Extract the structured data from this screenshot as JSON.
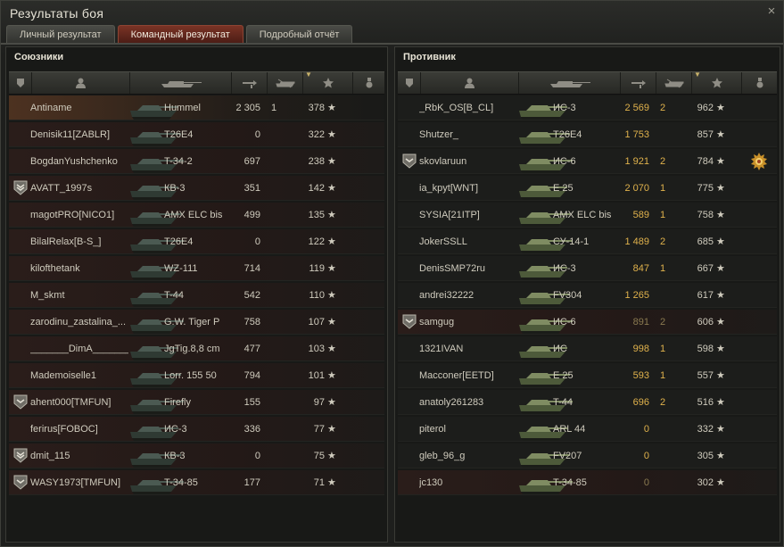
{
  "window": {
    "title": "Результаты боя",
    "close_label": "×"
  },
  "tabs": [
    {
      "label": "Личный результат",
      "active": false
    },
    {
      "label": "Командный результат",
      "active": true
    },
    {
      "label": "Подробный отчёт",
      "active": false
    }
  ],
  "allies": {
    "title": "Союзники",
    "rows": [
      {
        "player": "Antiname",
        "vehicle": "Hummel",
        "damage": "2 305",
        "kills": "1",
        "xp": "378",
        "badge": "",
        "state": "self"
      },
      {
        "player": "Denisik11[ZABLR]",
        "vehicle": "T26E4",
        "damage": "0",
        "kills": "",
        "xp": "322",
        "badge": "",
        "state": "dead"
      },
      {
        "player": "BogdanYushchenko",
        "vehicle": "T-34-2",
        "damage": "697",
        "kills": "",
        "xp": "238",
        "badge": "",
        "state": "dead"
      },
      {
        "player": "AVATT_1997s",
        "vehicle": "КВ-3",
        "damage": "351",
        "kills": "",
        "xp": "142",
        "badge": "2",
        "state": "dead"
      },
      {
        "player": "magotPRO[NICO1]",
        "vehicle": "AMX ELC bis",
        "damage": "499",
        "kills": "",
        "xp": "135",
        "badge": "",
        "state": "dead"
      },
      {
        "player": "BilalRelax[B-S_]",
        "vehicle": "T26E4",
        "damage": "0",
        "kills": "",
        "xp": "122",
        "badge": "",
        "state": "dead"
      },
      {
        "player": "kilofthetank",
        "vehicle": "WZ-111",
        "damage": "714",
        "kills": "",
        "xp": "119",
        "badge": "",
        "state": "dead"
      },
      {
        "player": "M_skmt",
        "vehicle": "T-44",
        "damage": "542",
        "kills": "",
        "xp": "110",
        "badge": "",
        "state": "dead"
      },
      {
        "player": "zarodinu_zastalina_...",
        "vehicle": "G.W. Tiger P",
        "damage": "758",
        "kills": "",
        "xp": "107",
        "badge": "",
        "state": "dead"
      },
      {
        "player": "_______DimA_______",
        "vehicle": "JgTig.8,8 cm",
        "damage": "477",
        "kills": "",
        "xp": "103",
        "badge": "",
        "state": "dead"
      },
      {
        "player": "Mademoiselle1",
        "vehicle": "Lorr. 155 50",
        "damage": "794",
        "kills": "",
        "xp": "101",
        "badge": "",
        "state": "dead"
      },
      {
        "player": "ahent000[TMFUN]",
        "vehicle": "Firefly",
        "damage": "155",
        "kills": "",
        "xp": "97",
        "badge": "1",
        "state": "dead"
      },
      {
        "player": "ferirus[FOBOC]",
        "vehicle": "ИС-3",
        "damage": "336",
        "kills": "",
        "xp": "77",
        "badge": "",
        "state": "dead"
      },
      {
        "player": "dmit_115",
        "vehicle": "КВ-3",
        "damage": "0",
        "kills": "",
        "xp": "75",
        "badge": "2",
        "state": "dead"
      },
      {
        "player": "WASY1973[TMFUN]",
        "vehicle": "T-34-85",
        "damage": "177",
        "kills": "",
        "xp": "71",
        "badge": "1",
        "state": "dead"
      }
    ]
  },
  "enemies": {
    "title": "Противник",
    "rows": [
      {
        "player": "_RbK_OS[B_CL]",
        "vehicle": "ИС-3",
        "damage": "2 569",
        "kills": "2",
        "xp": "962",
        "badge": "",
        "medal": false,
        "state": "alive"
      },
      {
        "player": "Shutzer_",
        "vehicle": "T26E4",
        "damage": "1 753",
        "kills": "",
        "xp": "857",
        "badge": "",
        "medal": false,
        "state": "alive"
      },
      {
        "player": "skovlaruun",
        "vehicle": "ИС-6",
        "damage": "1 921",
        "kills": "2",
        "xp": "784",
        "badge": "1",
        "medal": true,
        "state": "alive"
      },
      {
        "player": "ia_kpyt[WNT]",
        "vehicle": "E 25",
        "damage": "2 070",
        "kills": "1",
        "xp": "775",
        "badge": "",
        "medal": false,
        "state": "alive"
      },
      {
        "player": "SYSIA[21ITP]",
        "vehicle": "AMX ELC bis",
        "damage": "589",
        "kills": "1",
        "xp": "758",
        "badge": "",
        "medal": false,
        "state": "alive"
      },
      {
        "player": "JokerSSLL",
        "vehicle": "СУ-14-1",
        "damage": "1 489",
        "kills": "2",
        "xp": "685",
        "badge": "",
        "medal": false,
        "state": "alive"
      },
      {
        "player": "DenisSMP72ru",
        "vehicle": "ИС-3",
        "damage": "847",
        "kills": "1",
        "xp": "667",
        "badge": "",
        "medal": false,
        "state": "alive"
      },
      {
        "player": "andrei32222",
        "vehicle": "FV304",
        "damage": "1 265",
        "kills": "",
        "xp": "617",
        "badge": "",
        "medal": false,
        "state": "alive"
      },
      {
        "player": "samgug",
        "vehicle": "ИС-6",
        "damage": "891",
        "kills": "2",
        "xp": "606",
        "badge": "1",
        "medal": false,
        "state": "dead"
      },
      {
        "player": "1321IVAN",
        "vehicle": "ИС",
        "damage": "998",
        "kills": "1",
        "xp": "598",
        "badge": "",
        "medal": false,
        "state": "alive"
      },
      {
        "player": "Macconer[EETD]",
        "vehicle": "E 25",
        "damage": "593",
        "kills": "1",
        "xp": "557",
        "badge": "",
        "medal": false,
        "state": "alive"
      },
      {
        "player": "anatoly261283",
        "vehicle": "T-44",
        "damage": "696",
        "kills": "2",
        "xp": "516",
        "badge": "",
        "medal": false,
        "state": "alive"
      },
      {
        "player": "piterol",
        "vehicle": "ARL 44",
        "damage": "0",
        "kills": "",
        "xp": "332",
        "badge": "",
        "medal": false,
        "state": "alive"
      },
      {
        "player": "gleb_96_g",
        "vehicle": "FV207",
        "damage": "0",
        "kills": "",
        "xp": "305",
        "badge": "",
        "medal": false,
        "state": "alive"
      },
      {
        "player": "jc130",
        "vehicle": "T-34-85",
        "damage": "0",
        "kills": "",
        "xp": "302",
        "badge": "",
        "medal": false,
        "state": "dead"
      }
    ]
  },
  "colors": {
    "tab_active": "#7a3325",
    "damage_gold": "#e0b24c",
    "row_dead": "#2a1d1a"
  },
  "icons": {
    "columns": [
      "badge-icon",
      "player-icon",
      "tank-icon",
      "damage-icon",
      "kills-icon",
      "xp-star-icon",
      "medal-icon"
    ]
  }
}
